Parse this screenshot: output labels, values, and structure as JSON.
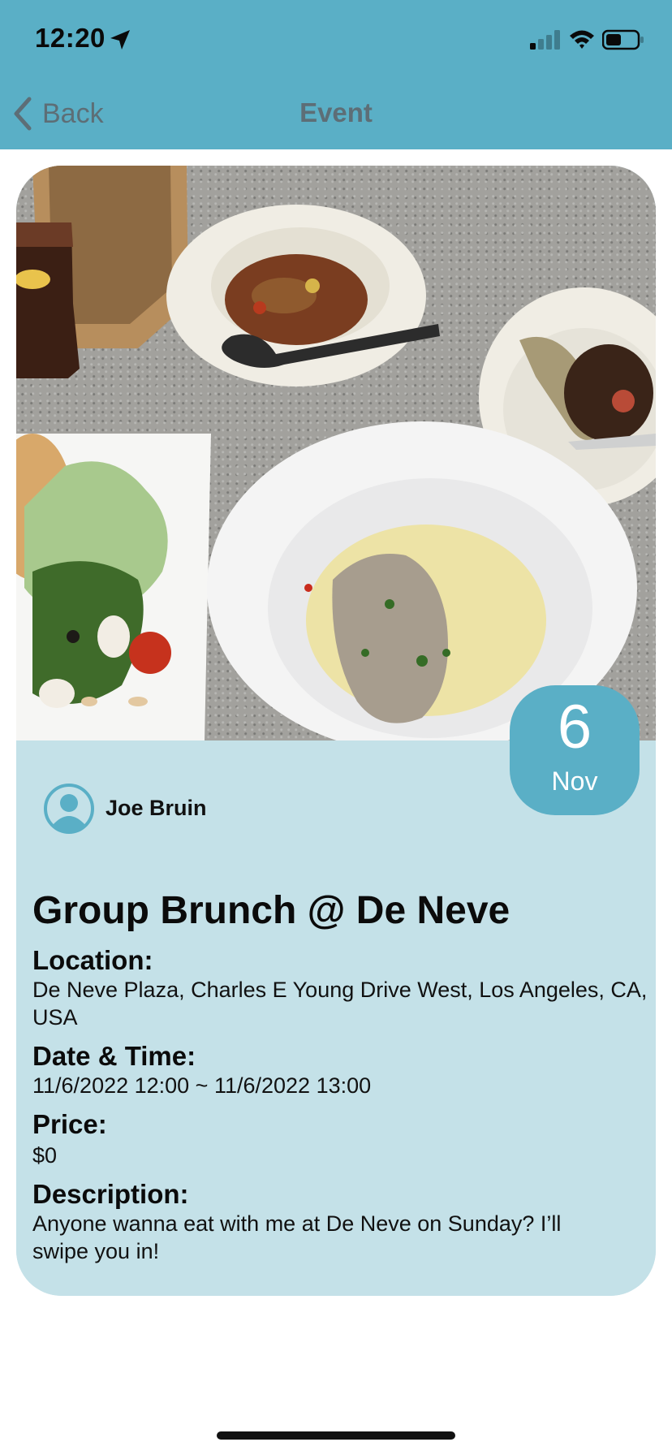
{
  "status_bar": {
    "time": "12:20"
  },
  "nav": {
    "back_label": "Back",
    "title": "Event"
  },
  "event": {
    "date_day": "6",
    "date_month": "Nov",
    "organizer": "Joe Bruin",
    "title": "Group Brunch @ De Neve",
    "location_label": "Location:",
    "location_value": "De Neve Plaza, Charles E Young Drive West, Los Angeles, CA, USA",
    "datetime_label": "Date & Time:",
    "datetime_value": "11/6/2022 12:00 ~ 11/6/2022 13:00",
    "price_label": "Price:",
    "price_value": "$0",
    "description_label": "Description:",
    "description_value": "Anyone wanna eat with me at De Neve on Sunday? I’ll swipe you in!"
  },
  "colors": {
    "header": "#5aafc6",
    "card": "#c4e1e8",
    "badge": "#5aafc6",
    "nav_text": "#5d6e76"
  }
}
